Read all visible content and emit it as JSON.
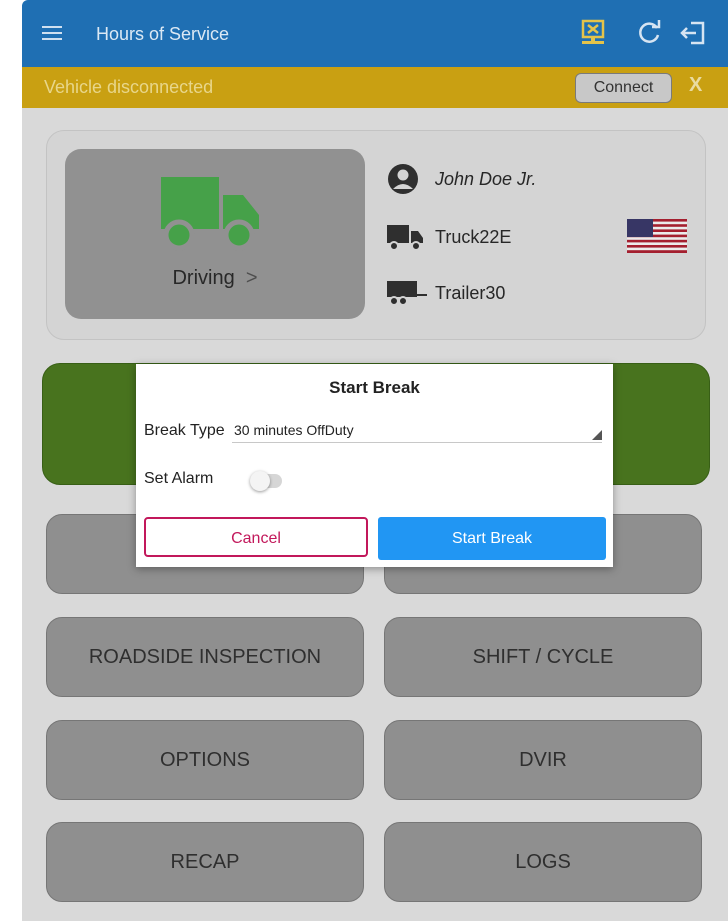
{
  "header": {
    "title": "Hours of Service",
    "icons": [
      "menu-icon",
      "eld-disconnected-icon",
      "refresh-icon",
      "logout-icon"
    ]
  },
  "alert": {
    "text": "Vehicle disconnected",
    "connect_label": "Connect",
    "dismiss_label": "X"
  },
  "profile": {
    "status": "Driving",
    "status_chevron": ">",
    "driver_name": "John Doe Jr.",
    "truck": "Truck22E",
    "trailer": "Trailer30"
  },
  "menu": {
    "buttons": [
      "ROADSIDE INSPECTION",
      "SHIFT / CYCLE",
      "OPTIONS",
      "DVIR",
      "RECAP",
      "LOGS"
    ]
  },
  "dialog": {
    "title": "Start Break",
    "break_type_label": "Break Type",
    "break_type_value": "30 minutes OffDuty",
    "alarm_label": "Set Alarm",
    "alarm_on": false,
    "cancel_label": "Cancel",
    "start_label": "Start Break"
  },
  "colors": {
    "header": "#1f6fb3",
    "alert": "#c9a012",
    "truck": "#4caf50",
    "green_card": "#4f7d21",
    "cancel": "#c2185b",
    "primary": "#2196f3"
  }
}
